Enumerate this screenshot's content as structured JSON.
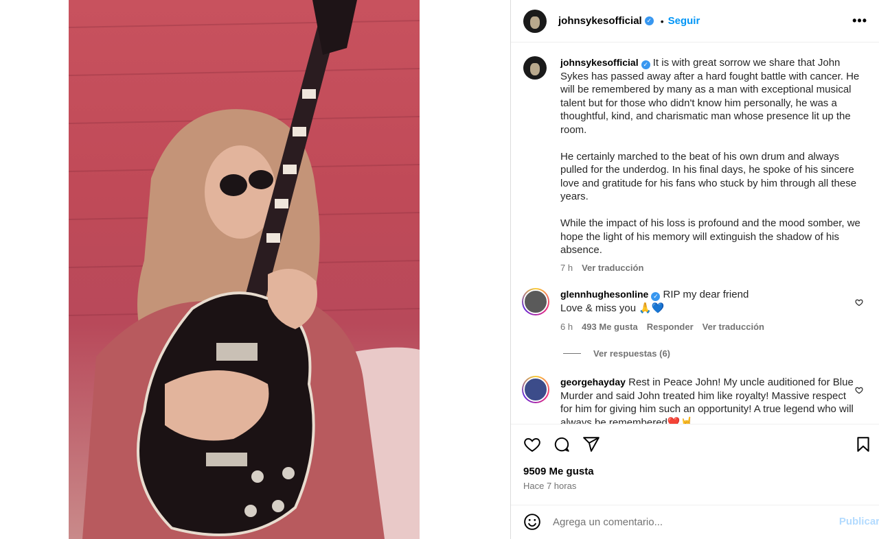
{
  "post": {
    "author": "johnsykesofficial",
    "follow_label": "Seguir",
    "separator": "•",
    "more_label": "•••",
    "verified_mark": "✓"
  },
  "caption": {
    "author": "johnsykesofficial",
    "paragraphs": [
      "It is with great sorrow we share that John Sykes has passed away after a hard fought battle with cancer. He will be remembered by many as a man with exceptional musical talent but for those who didn't know him personally, he was a thoughtful, kind, and charismatic man whose presence lit up the room.",
      "He certainly marched to the beat of his own drum and always pulled for the underdog. In his final days, he spoke of his sincere love and gratitude for his fans who stuck by him through all these years.",
      "While the impact of his loss is profound and the mood somber, we hope the light of his memory will extinguish the shadow of his absence."
    ],
    "time": "7 h",
    "translate": "Ver traducción"
  },
  "comments": [
    {
      "author": "glennhughesonline",
      "text_line1": "RIP my dear friend",
      "text_line2": "Love & miss you 🙏💙",
      "time": "6 h",
      "likes": "493 Me gusta",
      "reply": "Responder",
      "translate": "Ver traducción",
      "view_replies": "Ver respuestas (6)"
    },
    {
      "author": "georgehayday",
      "text": "Rest in Peace John! My uncle auditioned for Blue Murder and said John treated him like royalty! Massive respect for him for giving him such an opportunity! A true legend who will always be remembered❤️🤘"
    }
  ],
  "footer": {
    "likes": "9509 Me gusta",
    "time": "Hace 7 horas",
    "comment_placeholder": "Agrega un comentario...",
    "publish": "Publicar"
  },
  "icons": {
    "like": "heart-icon",
    "comment": "comment-icon",
    "share": "share-icon",
    "save": "bookmark-icon",
    "emoji": "emoji-icon",
    "more": "more-options-icon"
  },
  "colors": {
    "accent": "#0095f6",
    "verified": "#3897f0",
    "publish_disabled": "#b3dbff",
    "secondary_text": "#737373"
  }
}
